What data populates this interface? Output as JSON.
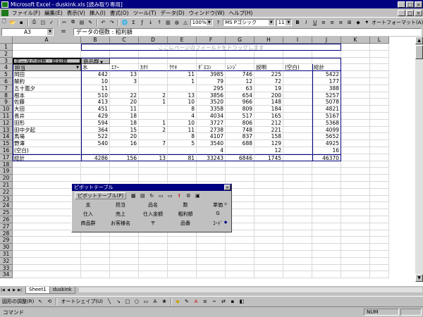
{
  "window": {
    "title": "Microsoft Excel - duskink.xls  [読み取り専用]",
    "controls": [
      "_",
      "□",
      "×"
    ],
    "doc_controls": [
      "_",
      "□",
      "×"
    ]
  },
  "menubar": [
    "ファイル(F)",
    "編集(E)",
    "表示(V)",
    "挿入(I)",
    "書式(O)",
    "ツール(T)",
    "データ(D)",
    "ウィンドウ(W)",
    "ヘルプ(H)"
  ],
  "toolbar": {
    "zoom": "100%",
    "font": "MS Pゴシック",
    "font_size": "11",
    "autoformat_label": "オートフォーマット(A)"
  },
  "formula_bar": {
    "cell_ref": "A3",
    "equals": "=",
    "content": "データの個数 : 粗利額"
  },
  "columns": [
    "A",
    "B",
    "C",
    "D",
    "E",
    "F",
    "G",
    "H",
    "I",
    "J",
    "K",
    "L"
  ],
  "rows": [
    "1",
    "2",
    "3",
    "4",
    "5",
    "6",
    "7",
    "8",
    "9",
    "10",
    "11",
    "12",
    "13",
    "14",
    "15",
    "16",
    "17",
    "18",
    "19",
    "20",
    "21",
    "22",
    "23",
    "24",
    "25",
    "26",
    "27",
    "28",
    "29",
    "30",
    "31",
    "32",
    "33",
    "34"
  ],
  "pivot": {
    "page_hint": "ここにページのフィールドをドラッグします",
    "data_field": "データの個数 : 粗利額",
    "column_field": "商品群",
    "row_field": "担当",
    "column_headers": [
      "水",
      "ｴｱｰ",
      "ｶｵﾘ",
      "ｸｹｷ",
      "ﾀﾞｽｺﾝ",
      "ﾚﾝｼﾞ",
      "説明",
      "(空白)",
      "総計"
    ],
    "rows": [
      {
        "label": "岡田",
        "values": [
          "442",
          "13",
          "",
          "11",
          "3985",
          "746",
          "225",
          "",
          "5422"
        ]
      },
      {
        "label": "解約",
        "values": [
          "10",
          "3",
          "",
          "1",
          "79",
          "12",
          "72",
          "",
          "177"
        ]
      },
      {
        "label": "五十嵐夕",
        "values": [
          "11",
          "",
          "",
          "",
          "295",
          "63",
          "19",
          "",
          "388"
        ]
      },
      {
        "label": "根本",
        "values": [
          "510",
          "22",
          "2",
          "13",
          "3856",
          "654",
          "200",
          "",
          "5257"
        ]
      },
      {
        "label": "佐藤",
        "values": [
          "413",
          "20",
          "1",
          "10",
          "3520",
          "966",
          "148",
          "",
          "5078"
        ]
      },
      {
        "label": "大田",
        "values": [
          "451",
          "11",
          "",
          "8",
          "3358",
          "809",
          "184",
          "",
          "4821"
        ]
      },
      {
        "label": "長井",
        "values": [
          "429",
          "18",
          "",
          "4",
          "4034",
          "517",
          "165",
          "",
          "5167"
        ]
      },
      {
        "label": "田形",
        "values": [
          "594",
          "18",
          "1",
          "10",
          "3727",
          "806",
          "212",
          "",
          "5368"
        ]
      },
      {
        "label": "田中夕起",
        "values": [
          "364",
          "15",
          "2",
          "11",
          "2738",
          "748",
          "221",
          "",
          "4099"
        ]
      },
      {
        "label": "馬場",
        "values": [
          "522",
          "20",
          "",
          "8",
          "4107",
          "837",
          "158",
          "",
          "5652"
        ]
      },
      {
        "label": "野澤",
        "values": [
          "540",
          "16",
          "7",
          "5",
          "3540",
          "688",
          "129",
          "",
          "4925"
        ]
      },
      {
        "label": "(空白)",
        "values": [
          "",
          "",
          "",
          "",
          "4",
          "",
          "12",
          "",
          "16"
        ]
      }
    ],
    "total": {
      "label": "総計",
      "values": [
        "4286",
        "156",
        "13",
        "81",
        "33243",
        "6846",
        "1745",
        "",
        "46370"
      ]
    }
  },
  "pivot_toolbar": {
    "title": "ピボットテーブル",
    "menu_label": "ピボットテーブル(P)",
    "fields": [
      [
        "支",
        "担当",
        "品名",
        "数",
        "単価"
      ],
      [
        "仕入",
        "売上",
        "仕入金額",
        "粗利額",
        "G"
      ],
      [
        "商品群",
        "お客様名",
        "〒",
        "品番",
        "ｺｰﾄﾞ"
      ]
    ]
  },
  "sheet_tabs": [
    "Sheet1",
    "duskink"
  ],
  "drawbar": {
    "draw_label": "図形の調整(R)",
    "autoshape_label": "オートシェイプ(U)"
  },
  "status": {
    "text": "コマンド",
    "num": "NUM"
  }
}
